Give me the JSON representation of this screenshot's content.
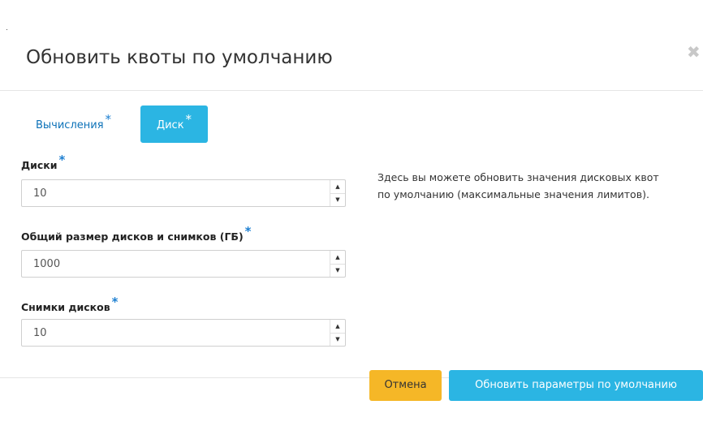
{
  "modal": {
    "title": "Обновить квоты по умолчанию",
    "close_glyph": "✖",
    "tabs": [
      {
        "label": "Вычисления",
        "required": "*",
        "active": false
      },
      {
        "label": "Диск",
        "required": "*",
        "active": true
      }
    ],
    "fields": [
      {
        "label": "Диски",
        "required": "*",
        "value": "10"
      },
      {
        "label": "Общий размер дисков и снимков (ГБ)",
        "required": "*",
        "value": "1000"
      },
      {
        "label": "Снимки дисков",
        "required": "*",
        "value": "10"
      }
    ],
    "spinner": {
      "up_glyph": "▲",
      "down_glyph": "▼"
    },
    "help_lines": [
      "Здесь вы можете обновить значения дисковых квот",
      "по умолчанию (максимальные значения лимитов)."
    ],
    "buttons": {
      "cancel": "Отмена",
      "submit": "Обновить параметры по умолчанию"
    }
  },
  "colors": {
    "accent": "#2bb5e3",
    "cancel": "#f5b727",
    "link": "#0d72b8"
  },
  "icons": {
    "close": "close-icon",
    "spinner_up": "chevron-up-icon",
    "spinner_down": "chevron-down-icon"
  }
}
